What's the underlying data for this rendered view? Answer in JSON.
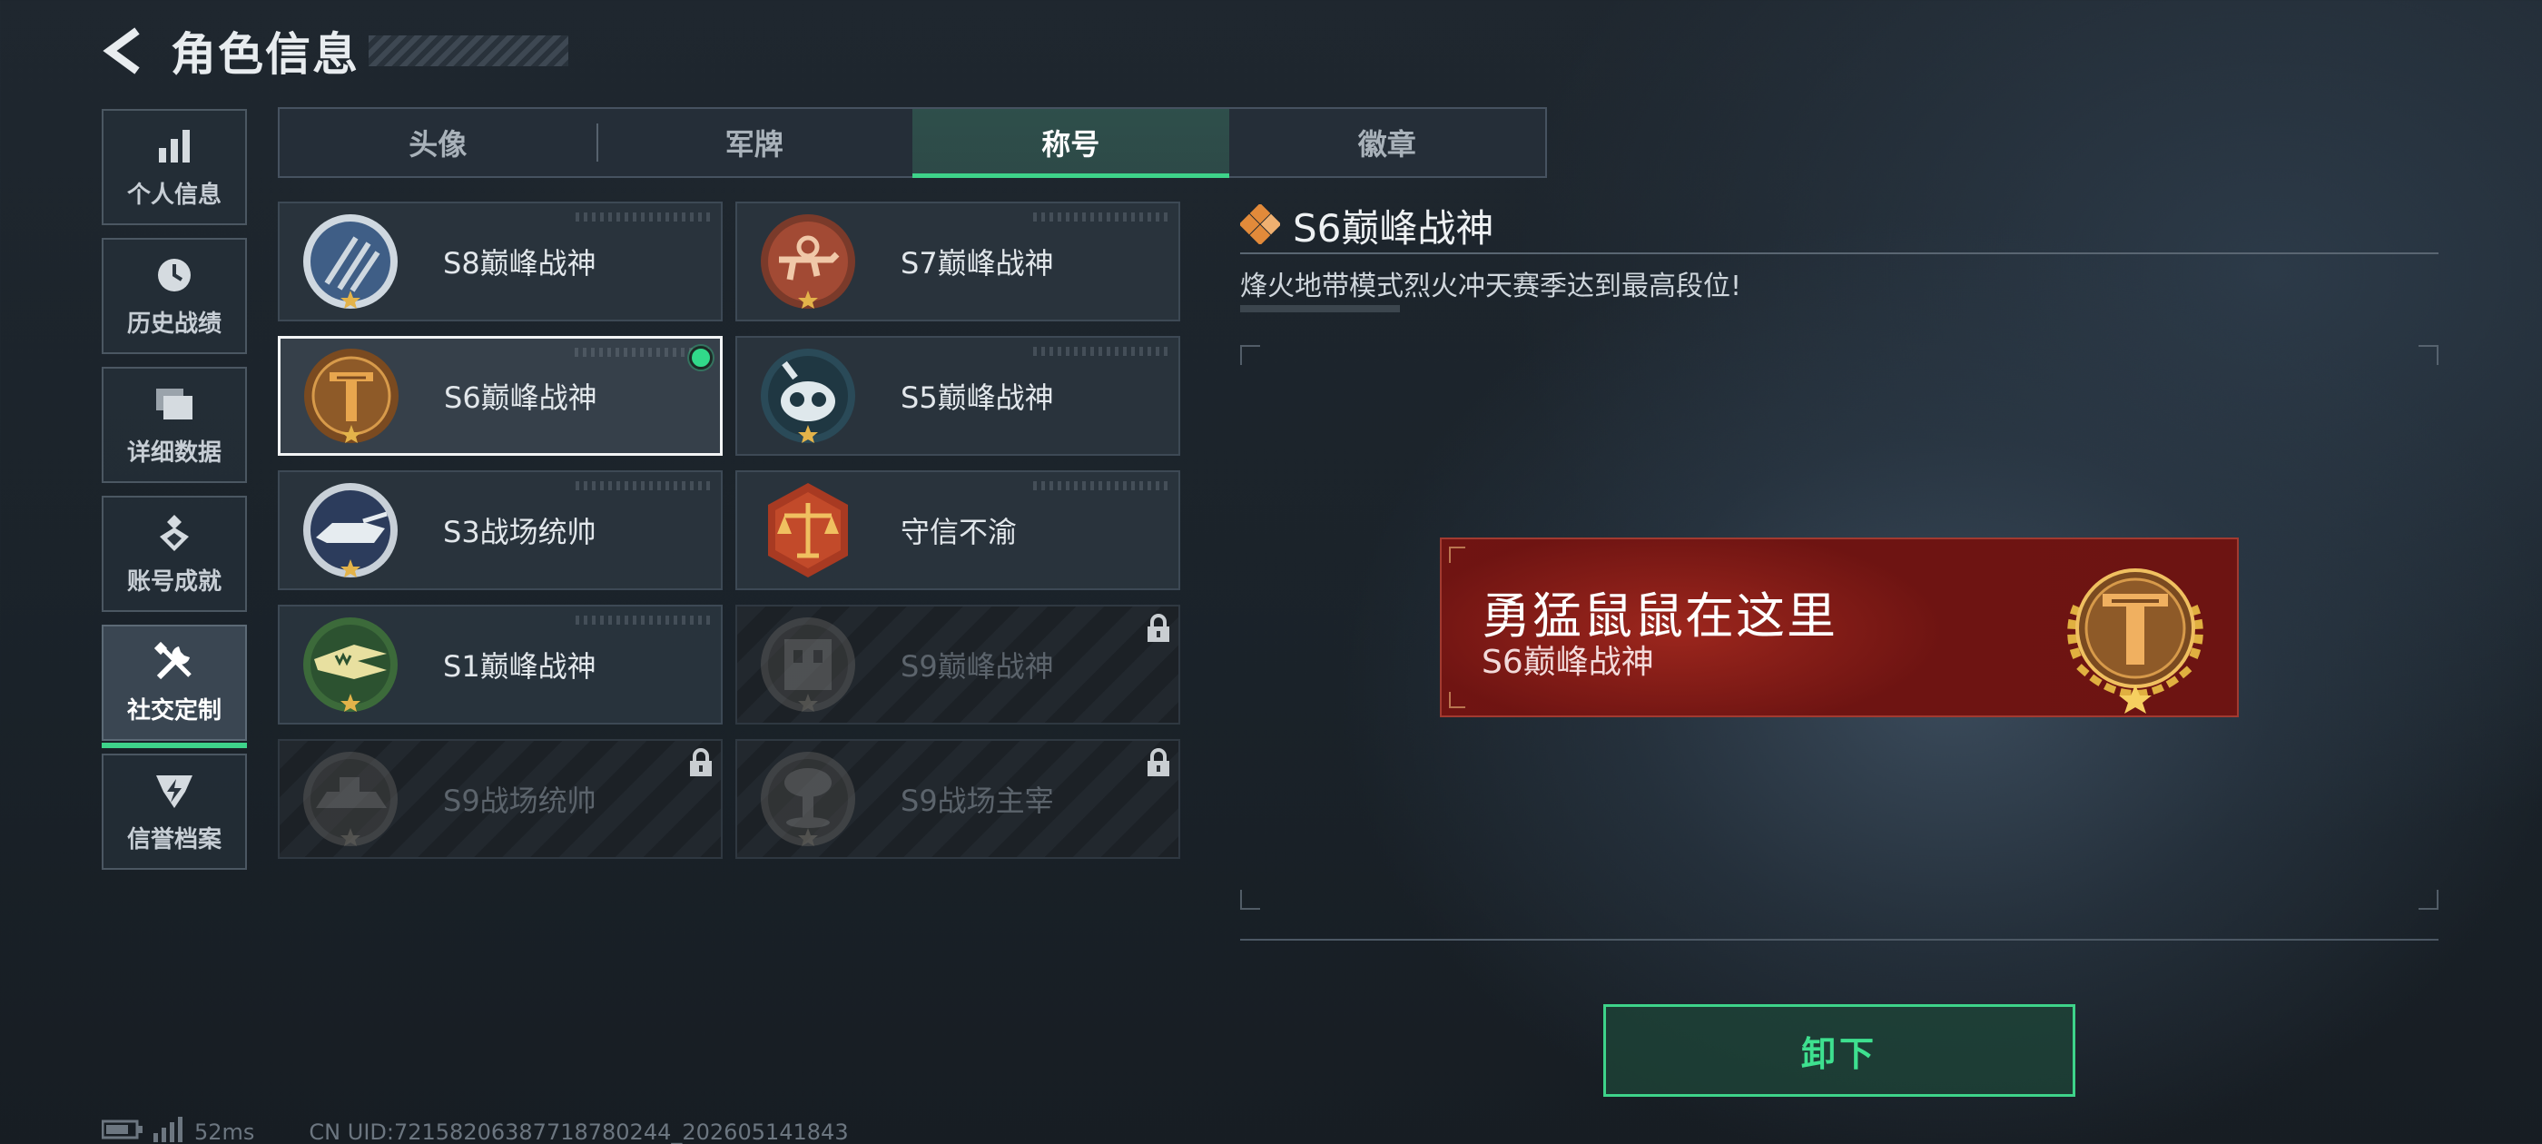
{
  "header": {
    "title": "角色信息"
  },
  "sidebar": {
    "items": [
      {
        "label": "个人信息",
        "icon": "bar-chart-icon"
      },
      {
        "label": "历史战绩",
        "icon": "clock-icon"
      },
      {
        "label": "详细数据",
        "icon": "folder-icon"
      },
      {
        "label": "账号成就",
        "icon": "achievement-icon"
      },
      {
        "label": "社交定制",
        "icon": "tools-icon",
        "active": true
      },
      {
        "label": "信誉档案",
        "icon": "credit-shield-icon"
      }
    ]
  },
  "tabs": [
    {
      "label": "头像"
    },
    {
      "label": "军牌"
    },
    {
      "label": "称号",
      "active": true
    },
    {
      "label": "徽章"
    }
  ],
  "titles": [
    {
      "name": "S8巅峰战神",
      "badge": "s8-badge-icon",
      "locked": false
    },
    {
      "name": "S7巅峰战神",
      "badge": "s7-badge-icon",
      "locked": false
    },
    {
      "name": "S6巅峰战神",
      "badge": "s6-badge-icon",
      "locked": false,
      "selected": true,
      "equipped": true
    },
    {
      "name": "S5巅峰战神",
      "badge": "s5-badge-icon",
      "locked": false
    },
    {
      "name": "S3战场统帅",
      "badge": "s3-badge-icon",
      "locked": false
    },
    {
      "name": "守信不渝",
      "badge": "scales-badge-icon",
      "locked": false
    },
    {
      "name": "S1巅峰战神",
      "badge": "s1-badge-icon",
      "locked": false
    },
    {
      "name": "S9巅峰战神",
      "badge": "s9-badge-icon",
      "locked": true
    },
    {
      "name": "S9战场统帅",
      "badge": "s9-commander-badge-icon",
      "locked": true
    },
    {
      "name": "S9战场主宰",
      "badge": "s9-dominator-badge-icon",
      "locked": true
    }
  ],
  "detail": {
    "title": "S6巅峰战神",
    "description": "烽火地带模式烈火冲天赛季达到最高段位!"
  },
  "preview": {
    "player_name": "勇猛鼠鼠在这里",
    "title": "S6巅峰战神"
  },
  "actions": {
    "unequip_label": "卸下"
  },
  "status": {
    "ping": "52ms",
    "uid": "CN UID:7215820638771878024​4_202605141843"
  },
  "colors": {
    "accent": "#3ed38a",
    "preview_bg": "#8c1c18",
    "selected_border": "#f2f4f5"
  }
}
